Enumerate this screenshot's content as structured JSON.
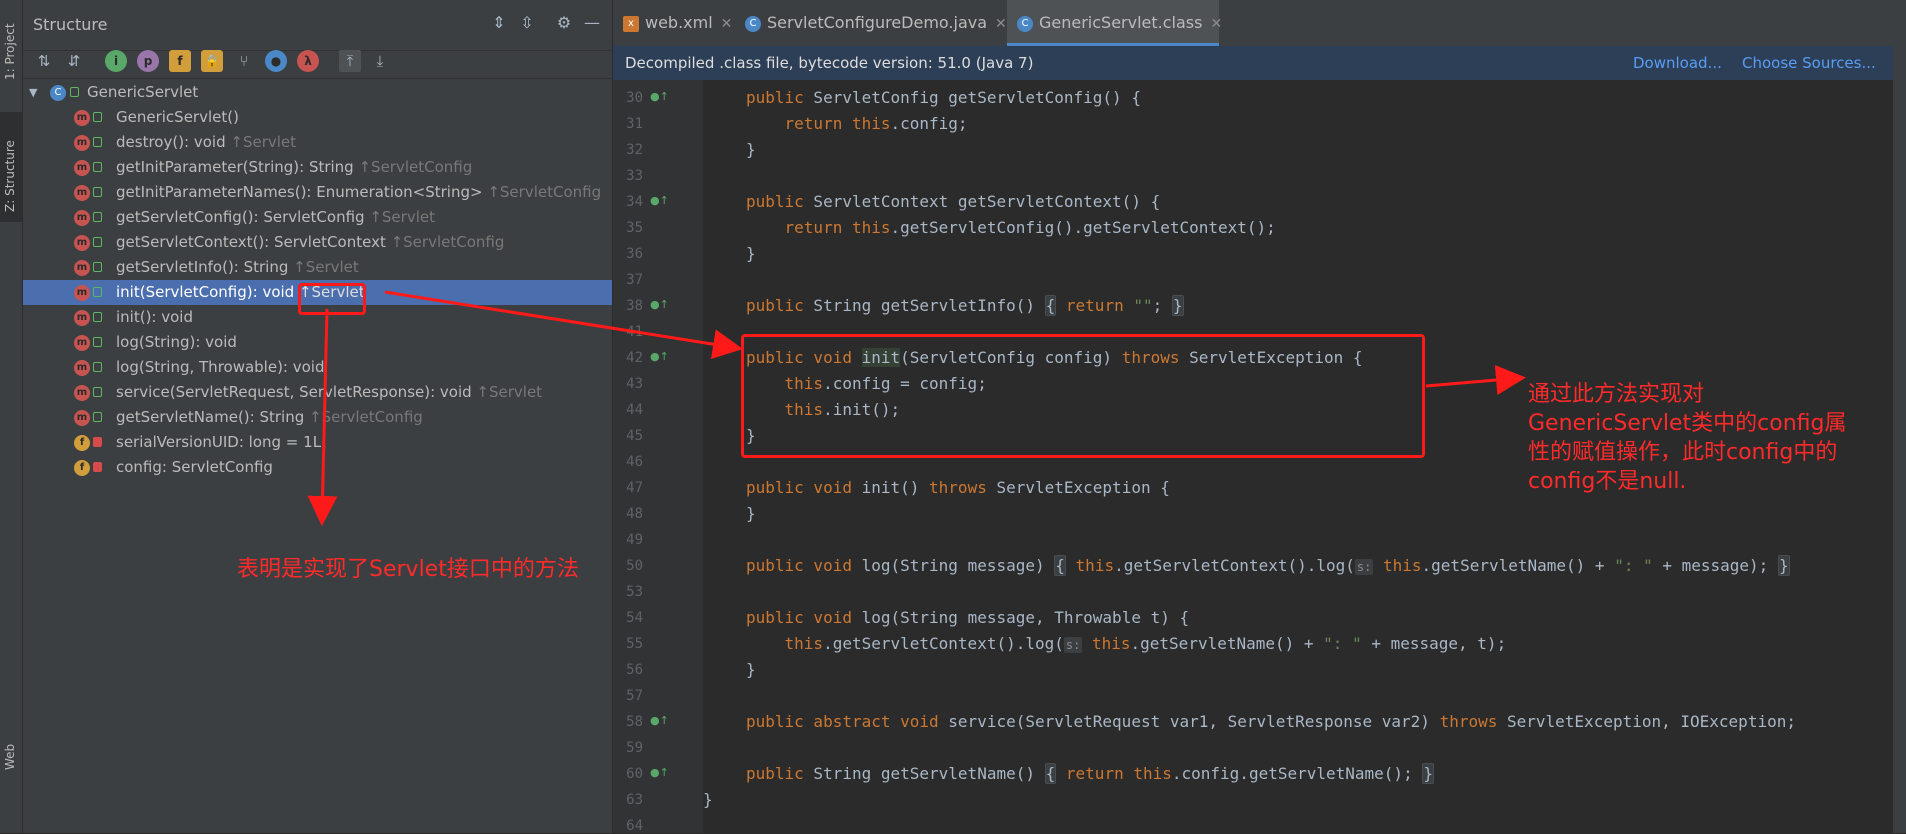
{
  "left_strip": {
    "tabs": [
      {
        "label": "1: Project"
      },
      {
        "label": "Z: Structure"
      },
      {
        "label": "Web"
      }
    ]
  },
  "structure": {
    "title": "Structure",
    "root": "GenericServlet",
    "items": [
      {
        "icon": "m",
        "label": "GenericServlet()",
        "inherited": ""
      },
      {
        "icon": "m",
        "label": "destroy(): void",
        "inherited": "↑Servlet"
      },
      {
        "icon": "m",
        "label": "getInitParameter(String): String",
        "inherited": "↑ServletConfig"
      },
      {
        "icon": "m",
        "label": "getInitParameterNames(): Enumeration<String>",
        "inherited": "↑ServletConfig"
      },
      {
        "icon": "m",
        "label": "getServletConfig(): ServletConfig",
        "inherited": "↑Servlet"
      },
      {
        "icon": "m",
        "label": "getServletContext(): ServletContext",
        "inherited": "↑ServletConfig"
      },
      {
        "icon": "m",
        "label": "getServletInfo(): String",
        "inherited": "↑Servlet"
      },
      {
        "icon": "m",
        "label": "init(ServletConfig): void",
        "inherited": "↑Servlet",
        "selected": true
      },
      {
        "icon": "m",
        "label": "init(): void",
        "inherited": ""
      },
      {
        "icon": "m",
        "label": "log(String): void",
        "inherited": ""
      },
      {
        "icon": "m",
        "label": "log(String, Throwable): void",
        "inherited": ""
      },
      {
        "icon": "m",
        "label": "service(ServletRequest, ServletResponse): void",
        "inherited": "↑Servlet"
      },
      {
        "icon": "m",
        "label": "getServletName(): String",
        "inherited": "↑ServletConfig"
      },
      {
        "icon": "f",
        "label": "serialVersionUID: long = 1L",
        "inherited": ""
      },
      {
        "icon": "f",
        "label": "config: ServletConfig",
        "inherited": ""
      }
    ]
  },
  "editor": {
    "tabs": [
      {
        "label": "web.xml"
      },
      {
        "label": "ServletConfigureDemo.java"
      },
      {
        "label": "GenericServlet.class",
        "active": true
      }
    ],
    "banner": {
      "text": "Decompiled .class file, bytecode version: 51.0 (Java 7)",
      "download": "Download...",
      "choose_sources": "Choose Sources..."
    },
    "line_numbers": [
      "30",
      "31",
      "32",
      "33",
      "34",
      "35",
      "36",
      "37",
      "38",
      "41",
      "42",
      "43",
      "44",
      "45",
      "46",
      "47",
      "48",
      "49",
      "50",
      "53",
      "54",
      "55",
      "56",
      "57",
      "58",
      "59",
      "60",
      "63",
      "64"
    ]
  },
  "annotations": {
    "left_note": "表明是实现了Servlet接口中的方法",
    "right_note": [
      "通过此方法实现对",
      "GenericServlet类中的config属",
      "性的赋值操作，此时config中的",
      "config不是null."
    ]
  },
  "colors": {
    "annotation": "#ff1a1a",
    "selection": "#4b6eaf",
    "keyword": "#cc7832"
  }
}
